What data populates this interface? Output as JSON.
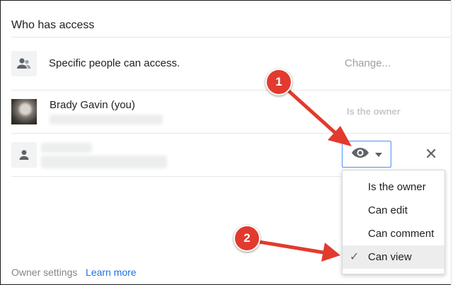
{
  "panel": {
    "title": "Who has access",
    "general_access": {
      "text": "Specific people can access.",
      "action": "Change..."
    },
    "people": [
      {
        "name": "Brady Gavin (you)",
        "role": "Is the owner"
      }
    ],
    "permission_menu": {
      "items": [
        {
          "label": "Is the owner",
          "selected": false
        },
        {
          "label": "Can edit",
          "selected": false
        },
        {
          "label": "Can comment",
          "selected": false
        },
        {
          "label": "Can view",
          "selected": true
        }
      ],
      "check_icon": "checkmark-icon"
    },
    "footer": {
      "label": "Owner settings",
      "link": "Learn more"
    }
  },
  "callouts": [
    {
      "number": "1"
    },
    {
      "number": "2"
    }
  ],
  "colors": {
    "accent_blue": "#1a73e8",
    "button_border": "#4d90fe",
    "callout_red": "#e23a2e"
  }
}
